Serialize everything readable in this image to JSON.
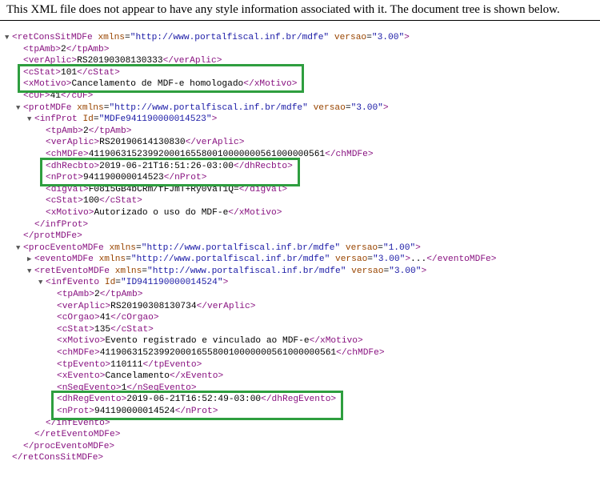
{
  "header_text": "This XML file does not appear to have any style information associated with it. The document tree is shown below.",
  "tree": [
    {
      "indent": 0,
      "toggle": "open",
      "parts": [
        [
          "tag",
          "<retConsSitMDFe"
        ],
        [
          "txt",
          " "
        ],
        [
          "attr",
          "xmlns"
        ],
        [
          "txt",
          "="
        ],
        [
          "val",
          "\"http://www.portalfiscal.inf.br/mdfe\""
        ],
        [
          "txt",
          " "
        ],
        [
          "attr",
          "versao"
        ],
        [
          "txt",
          "="
        ],
        [
          "val",
          "\"3.00\""
        ],
        [
          "tag",
          ">"
        ]
      ]
    },
    {
      "indent": 1,
      "parts": [
        [
          "tag",
          "<tpAmb>"
        ],
        [
          "txt",
          "2"
        ],
        [
          "tag",
          "</tpAmb>"
        ]
      ]
    },
    {
      "indent": 1,
      "parts": [
        [
          "tag",
          "<verAplic>"
        ],
        [
          "txt",
          "RS20190308130333"
        ],
        [
          "tag",
          "</verAplic>"
        ]
      ]
    },
    {
      "indent": 1,
      "parts": [
        [
          "tag",
          "<cStat>"
        ],
        [
          "txt",
          "101"
        ],
        [
          "tag",
          "</cStat>"
        ]
      ]
    },
    {
      "indent": 1,
      "parts": [
        [
          "tag",
          "<xMotivo>"
        ],
        [
          "txt",
          "Cancelamento de MDF-e homologado"
        ],
        [
          "tag",
          "</xMotivo>"
        ]
      ]
    },
    {
      "indent": 1,
      "parts": [
        [
          "tag",
          "<cUF>"
        ],
        [
          "txt",
          "41"
        ],
        [
          "tag",
          "</cUF>"
        ]
      ]
    },
    {
      "indent": 1,
      "toggle": "open",
      "parts": [
        [
          "tag",
          "<protMDFe"
        ],
        [
          "txt",
          " "
        ],
        [
          "attr",
          "xmlns"
        ],
        [
          "txt",
          "="
        ],
        [
          "val",
          "\"http://www.portalfiscal.inf.br/mdfe\""
        ],
        [
          "txt",
          " "
        ],
        [
          "attr",
          "versao"
        ],
        [
          "txt",
          "="
        ],
        [
          "val",
          "\"3.00\""
        ],
        [
          "tag",
          ">"
        ]
      ]
    },
    {
      "indent": 2,
      "toggle": "open",
      "parts": [
        [
          "tag",
          "<infProt"
        ],
        [
          "txt",
          " "
        ],
        [
          "attr",
          "Id"
        ],
        [
          "txt",
          "="
        ],
        [
          "val",
          "\"MDFe941190000014523\""
        ],
        [
          "tag",
          ">"
        ]
      ]
    },
    {
      "indent": 3,
      "parts": [
        [
          "tag",
          "<tpAmb>"
        ],
        [
          "txt",
          "2"
        ],
        [
          "tag",
          "</tpAmb>"
        ]
      ]
    },
    {
      "indent": 3,
      "parts": [
        [
          "tag",
          "<verAplic>"
        ],
        [
          "txt",
          "RS20190614130830"
        ],
        [
          "tag",
          "</verAplic>"
        ]
      ]
    },
    {
      "indent": 3,
      "parts": [
        [
          "tag",
          "<chMDFe>"
        ],
        [
          "txt",
          "41190631523992000165580010000000561000000561"
        ],
        [
          "tag",
          "</chMDFe>"
        ]
      ]
    },
    {
      "indent": 3,
      "parts": [
        [
          "tag",
          "<dhRecbto>"
        ],
        [
          "txt",
          "2019-06-21T16:51:26-03:00"
        ],
        [
          "tag",
          "</dhRecbto>"
        ]
      ]
    },
    {
      "indent": 3,
      "parts": [
        [
          "tag",
          "<nProt>"
        ],
        [
          "txt",
          "941190000014523"
        ],
        [
          "tag",
          "</nProt>"
        ]
      ]
    },
    {
      "indent": 3,
      "parts": [
        [
          "tag",
          "<digVal>"
        ],
        [
          "txt",
          "F0815GB4bCRm/fFJmT+Ry0VaT1Q="
        ],
        [
          "tag",
          "</digVal>"
        ]
      ]
    },
    {
      "indent": 3,
      "parts": [
        [
          "tag",
          "<cStat>"
        ],
        [
          "txt",
          "100"
        ],
        [
          "tag",
          "</cStat>"
        ]
      ]
    },
    {
      "indent": 3,
      "parts": [
        [
          "tag",
          "<xMotivo>"
        ],
        [
          "txt",
          "Autorizado o uso do MDF-e"
        ],
        [
          "tag",
          "</xMotivo>"
        ]
      ]
    },
    {
      "indent": 2,
      "parts": [
        [
          "tag",
          "</infProt>"
        ]
      ]
    },
    {
      "indent": 1,
      "parts": [
        [
          "tag",
          "</protMDFe>"
        ]
      ]
    },
    {
      "indent": 1,
      "toggle": "open",
      "parts": [
        [
          "tag",
          "<procEventoMDFe"
        ],
        [
          "txt",
          " "
        ],
        [
          "attr",
          "xmlns"
        ],
        [
          "txt",
          "="
        ],
        [
          "val",
          "\"http://www.portalfiscal.inf.br/mdfe\""
        ],
        [
          "txt",
          " "
        ],
        [
          "attr",
          "versao"
        ],
        [
          "txt",
          "="
        ],
        [
          "val",
          "\"1.00\""
        ],
        [
          "tag",
          ">"
        ]
      ]
    },
    {
      "indent": 2,
      "toggle": "closed",
      "parts": [
        [
          "tag",
          "<eventoMDFe"
        ],
        [
          "txt",
          " "
        ],
        [
          "attr",
          "xmlns"
        ],
        [
          "txt",
          "="
        ],
        [
          "val",
          "\"http://www.portalfiscal.inf.br/mdfe\""
        ],
        [
          "txt",
          " "
        ],
        [
          "attr",
          "versao"
        ],
        [
          "txt",
          "="
        ],
        [
          "val",
          "\"3.00\""
        ],
        [
          "tag",
          ">"
        ],
        [
          "txt",
          "..."
        ],
        [
          "tag",
          "</eventoMDFe>"
        ]
      ]
    },
    {
      "indent": 2,
      "toggle": "open",
      "parts": [
        [
          "tag",
          "<retEventoMDFe"
        ],
        [
          "txt",
          " "
        ],
        [
          "attr",
          "xmlns"
        ],
        [
          "txt",
          "="
        ],
        [
          "val",
          "\"http://www.portalfiscal.inf.br/mdfe\""
        ],
        [
          "txt",
          " "
        ],
        [
          "attr",
          "versao"
        ],
        [
          "txt",
          "="
        ],
        [
          "val",
          "\"3.00\""
        ],
        [
          "tag",
          ">"
        ]
      ]
    },
    {
      "indent": 3,
      "toggle": "open",
      "parts": [
        [
          "tag",
          "<infEvento"
        ],
        [
          "txt",
          " "
        ],
        [
          "attr",
          "Id"
        ],
        [
          "txt",
          "="
        ],
        [
          "val",
          "\"ID941190000014524\""
        ],
        [
          "tag",
          ">"
        ]
      ]
    },
    {
      "indent": 4,
      "parts": [
        [
          "tag",
          "<tpAmb>"
        ],
        [
          "txt",
          "2"
        ],
        [
          "tag",
          "</tpAmb>"
        ]
      ]
    },
    {
      "indent": 4,
      "parts": [
        [
          "tag",
          "<verAplic>"
        ],
        [
          "txt",
          "RS20190308130734"
        ],
        [
          "tag",
          "</verAplic>"
        ]
      ]
    },
    {
      "indent": 4,
      "parts": [
        [
          "tag",
          "<cOrgao>"
        ],
        [
          "txt",
          "41"
        ],
        [
          "tag",
          "</cOrgao>"
        ]
      ]
    },
    {
      "indent": 4,
      "parts": [
        [
          "tag",
          "<cStat>"
        ],
        [
          "txt",
          "135"
        ],
        [
          "tag",
          "</cStat>"
        ]
      ]
    },
    {
      "indent": 4,
      "parts": [
        [
          "tag",
          "<xMotivo>"
        ],
        [
          "txt",
          "Evento registrado e vinculado ao MDF-e"
        ],
        [
          "tag",
          "</xMotivo>"
        ]
      ]
    },
    {
      "indent": 4,
      "parts": [
        [
          "tag",
          "<chMDFe>"
        ],
        [
          "txt",
          "41190631523992000165580010000000561000000561"
        ],
        [
          "tag",
          "</chMDFe>"
        ]
      ]
    },
    {
      "indent": 4,
      "parts": [
        [
          "tag",
          "<tpEvento>"
        ],
        [
          "txt",
          "110111"
        ],
        [
          "tag",
          "</tpEvento>"
        ]
      ]
    },
    {
      "indent": 4,
      "parts": [
        [
          "tag",
          "<xEvento>"
        ],
        [
          "txt",
          "Cancelamento"
        ],
        [
          "tag",
          "</xEvento>"
        ]
      ]
    },
    {
      "indent": 4,
      "parts": [
        [
          "tag",
          "<nSeqEvento>"
        ],
        [
          "txt",
          "1"
        ],
        [
          "tag",
          "</nSeqEvento>"
        ]
      ]
    },
    {
      "indent": 4,
      "parts": [
        [
          "tag",
          "<dhRegEvento>"
        ],
        [
          "txt",
          "2019-06-21T16:52:49-03:00"
        ],
        [
          "tag",
          "</dhRegEvento>"
        ]
      ]
    },
    {
      "indent": 4,
      "parts": [
        [
          "tag",
          "<nProt>"
        ],
        [
          "txt",
          "941190000014524"
        ],
        [
          "tag",
          "</nProt>"
        ]
      ]
    },
    {
      "indent": 3,
      "parts": [
        [
          "tag",
          "</infEvento>"
        ]
      ]
    },
    {
      "indent": 2,
      "parts": [
        [
          "tag",
          "</retEventoMDFe>"
        ]
      ]
    },
    {
      "indent": 1,
      "parts": [
        [
          "tag",
          "</procEventoMDFe>"
        ]
      ]
    },
    {
      "indent": 0,
      "parts": [
        [
          "tag",
          "</retConsSitMDFe>"
        ]
      ]
    }
  ],
  "highlights": [
    {
      "first_line": 3,
      "last_line": 4
    },
    {
      "first_line": 11,
      "last_line": 12
    },
    {
      "first_line": 31,
      "last_line": 32
    }
  ],
  "colors": {
    "tag": "#881280",
    "attr": "#994500",
    "val": "#1a1aa6",
    "highlight": "#2e9e3f"
  }
}
